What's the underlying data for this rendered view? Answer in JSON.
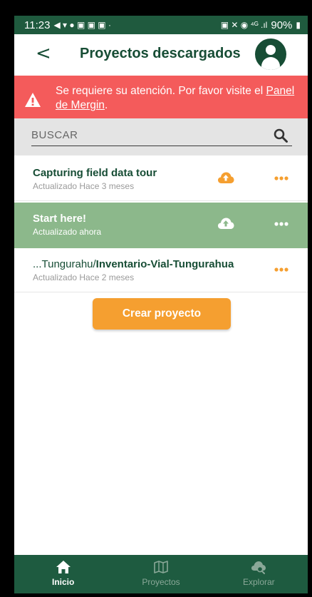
{
  "status_bar": {
    "time": "11:23",
    "left_glyphs": "◀ ▾ ● ▣ ▣ ▣ ·",
    "right_glyphs": "▣ ✕ ◉ ⁴ᴳ .ıl",
    "battery": "90%"
  },
  "header": {
    "title": "Proyectos descargados",
    "back_icon": "chevron-left-icon",
    "avatar_icon": "user-avatar-icon"
  },
  "alert": {
    "message": "Se requiere su atención. Por favor visite el ",
    "link": "Panel de Mergin",
    "suffix": ".",
    "color": "#f45b5b"
  },
  "search": {
    "placeholder": "BUSCAR"
  },
  "projects": [
    {
      "title": "Capturing field data tour",
      "subtitle": "Actualizado Hace 3 meses",
      "sync_icon": "cloud-upload-icon",
      "menu_icon": "more-dots-icon"
    },
    {
      "title": "Start here!",
      "subtitle": "Actualizado ahora",
      "sync_icon": "cloud-upload-icon",
      "menu_icon": "more-dots-icon"
    },
    {
      "title_path": "...Tungurahu/",
      "title_name": "Inventario-Vial-Tungurahua",
      "subtitle": "Actualizado Hace 2 meses",
      "menu_icon": "more-dots-icon"
    }
  ],
  "create_button": {
    "label": "Crear proyecto"
  },
  "navbar": {
    "items": [
      {
        "label": "Inicio",
        "icon": "home-icon",
        "active": true
      },
      {
        "label": "Proyectos",
        "icon": "map-icon",
        "active": false
      },
      {
        "label": "Explorar",
        "icon": "explore-icon",
        "active": false
      }
    ]
  },
  "colors": {
    "brand_green": "#174d35",
    "navbar": "#1e5b40",
    "accent_orange": "#f59f30",
    "selected_row": "#8cb88b"
  }
}
